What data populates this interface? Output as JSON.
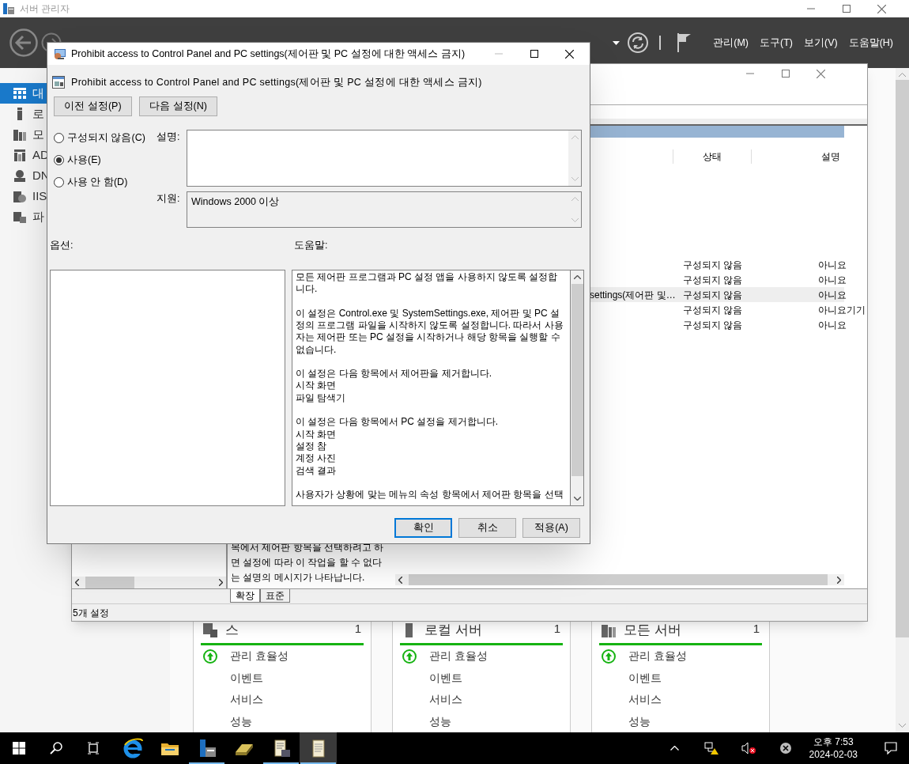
{
  "server_manager": {
    "title": "서버 관리자",
    "menus": [
      "관리(M)",
      "도구(T)",
      "보기(V)",
      "도움말(H)"
    ],
    "nav": [
      {
        "label": "대",
        "kind": "dashboard",
        "selected": true
      },
      {
        "label": "로",
        "kind": "server",
        "selected": false
      },
      {
        "label": "모",
        "kind": "servers",
        "selected": false
      },
      {
        "label": "AD",
        "kind": "ad",
        "selected": false
      },
      {
        "label": "DN",
        "kind": "dns",
        "selected": false
      },
      {
        "label": "IIS",
        "kind": "iis",
        "selected": false
      },
      {
        "label": "파",
        "kind": "files",
        "selected": false
      }
    ],
    "tiles": [
      {
        "kind": "files",
        "title": "스",
        "count": "1",
        "rows": [
          {
            "label": "관리 효율성",
            "healthy": true
          },
          {
            "label": "이벤트",
            "healthy": false
          },
          {
            "label": "서비스",
            "healthy": false
          },
          {
            "label": "성능",
            "healthy": false
          }
        ]
      },
      {
        "kind": "server",
        "title": "로컬 서버",
        "count": "1",
        "rows": [
          {
            "label": "관리 효율성",
            "healthy": true
          },
          {
            "label": "이벤트",
            "healthy": false
          },
          {
            "label": "서비스",
            "healthy": false
          },
          {
            "label": "성능",
            "healthy": false
          }
        ]
      },
      {
        "kind": "servers",
        "title": "모든 서버",
        "count": "1",
        "rows": [
          {
            "label": "관리 효율성",
            "healthy": true
          },
          {
            "label": "이벤트",
            "healthy": false
          },
          {
            "label": "서비스",
            "healthy": false
          },
          {
            "label": "성능",
            "healthy": false
          }
        ]
      }
    ]
  },
  "gpedit": {
    "columns": [
      "상태",
      "설명"
    ],
    "rows": [
      {
        "state": "구성되지 않음",
        "comment": "아니요",
        "selected": false
      },
      {
        "state": "구성되지 않음",
        "comment": "아니요",
        "selected": false
      },
      {
        "name": "settings(제어판 및…",
        "state": "구성되지 않음",
        "comment": "아니요",
        "selected": true
      },
      {
        "state": "구성되지 않음",
        "comment": "아니요기기",
        "selected": false
      },
      {
        "state": "구성되지 않음",
        "comment": "아니요",
        "selected": false
      }
    ],
    "explain_lines": [
      "목에서 제어판 항목을 선택하려고 하",
      "면 설정에 따라 이 작업을 할 수 없다",
      "는 설명의 메시지가 나타납니다."
    ],
    "tabs": [
      {
        "label": "확장",
        "selected": true
      },
      {
        "label": "표준",
        "selected": false
      }
    ],
    "status": "5개 설정"
  },
  "dialog": {
    "title": "Prohibit access to Control Panel and PC settings(제어판 및 PC 설정에 대한 액세스 금지)",
    "heading": "Prohibit access to Control Panel and PC settings(제어판 및 PC 설정에 대한 액세스 금지)",
    "nav_buttons": [
      "이전 설정(P)",
      "다음 설정(N)"
    ],
    "options": [
      {
        "label": "구성되지 않음(C)",
        "selected": false
      },
      {
        "label": "사용(E)",
        "selected": true
      },
      {
        "label": "사용 안 함(D)",
        "selected": false
      }
    ],
    "comment_label": "설명:",
    "supported_label": "지원:",
    "supported": "Windows 2000 이상",
    "options_label": "옵션:",
    "help_label": "도움말:",
    "help": [
      [
        "모든 제어판 프로그램과 PC 설정 앱을 사용하지 않도록 설정합",
        "니다."
      ],
      [
        "이 설정은 Control.exe 및 SystemSettings.exe, 제어판 및 PC 설",
        "정의 프로그램 파일을 시작하지 않도록 설정합니다. 따라서 사용",
        "자는 제어판 또는 PC 설정을 시작하거나 해당 항목을 실행할 수",
        "없습니다."
      ],
      [
        "이 설정은 다음 항목에서 제어판을 제거합니다.",
        "시작 화면",
        "파일 탐색기"
      ],
      [
        "이 설정은 다음 항목에서 PC 설정을 제거합니다.",
        "시작 화면",
        "설정 참",
        "계정 사진",
        "검색 결과"
      ],
      [
        "사용자가 상황에 맞는 메뉴의 속성 항목에서 제어판 항목을 선택"
      ]
    ],
    "buttons": [
      {
        "label": "확인",
        "focused": true
      },
      {
        "label": "취소",
        "focused": false
      },
      {
        "label": "적용(A)",
        "focused": false
      }
    ]
  },
  "taskbar": {
    "apps": [
      {
        "kind": "browser",
        "open": false,
        "selected": false
      },
      {
        "kind": "folder",
        "open": false,
        "selected": false
      },
      {
        "kind": "server",
        "open": true,
        "selected": false
      },
      {
        "kind": "scanner",
        "open": false,
        "selected": false
      },
      {
        "kind": "scroll-tool",
        "open": true,
        "selected": false
      },
      {
        "kind": "scroll",
        "open": true,
        "selected": true
      }
    ],
    "clock": {
      "time": "오후 7:53",
      "date": "2024-02-03"
    }
  }
}
